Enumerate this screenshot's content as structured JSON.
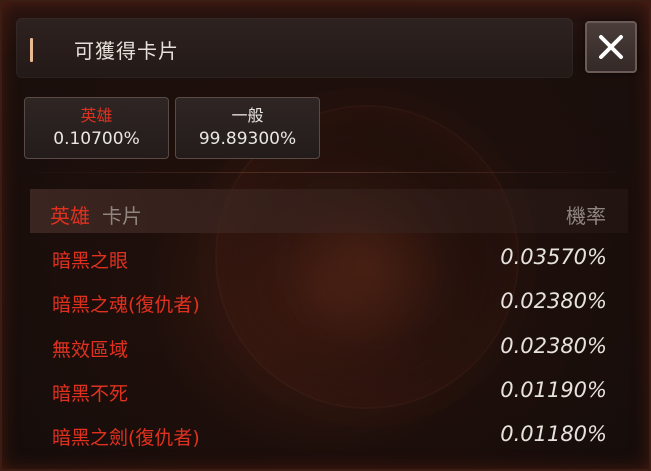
{
  "header": {
    "title": "可獲得卡片",
    "close_icon": "close-icon"
  },
  "tabs": [
    {
      "name": "英雄",
      "pct": "0.10700%",
      "name_color": "#e0311f"
    },
    {
      "name": "一般",
      "pct": "99.89300%",
      "name_color": "#e9e6e2"
    }
  ],
  "table": {
    "grade_label": "英雄",
    "card_label": "卡片",
    "rate_label": "機率",
    "rows": [
      {
        "name": "暗黑之眼",
        "rate": "0.03570%"
      },
      {
        "name": "暗黑之魂(復仇者)",
        "rate": "0.02380%"
      },
      {
        "name": "無效區域",
        "rate": "0.02380%"
      },
      {
        "name": "暗黑不死",
        "rate": "0.01190%"
      },
      {
        "name": "暗黑之劍(復仇者)",
        "rate": "0.01180%"
      }
    ]
  },
  "colors": {
    "hero_red": "#e0311f",
    "text_light": "#e6e2de",
    "muted": "#8f8680"
  }
}
